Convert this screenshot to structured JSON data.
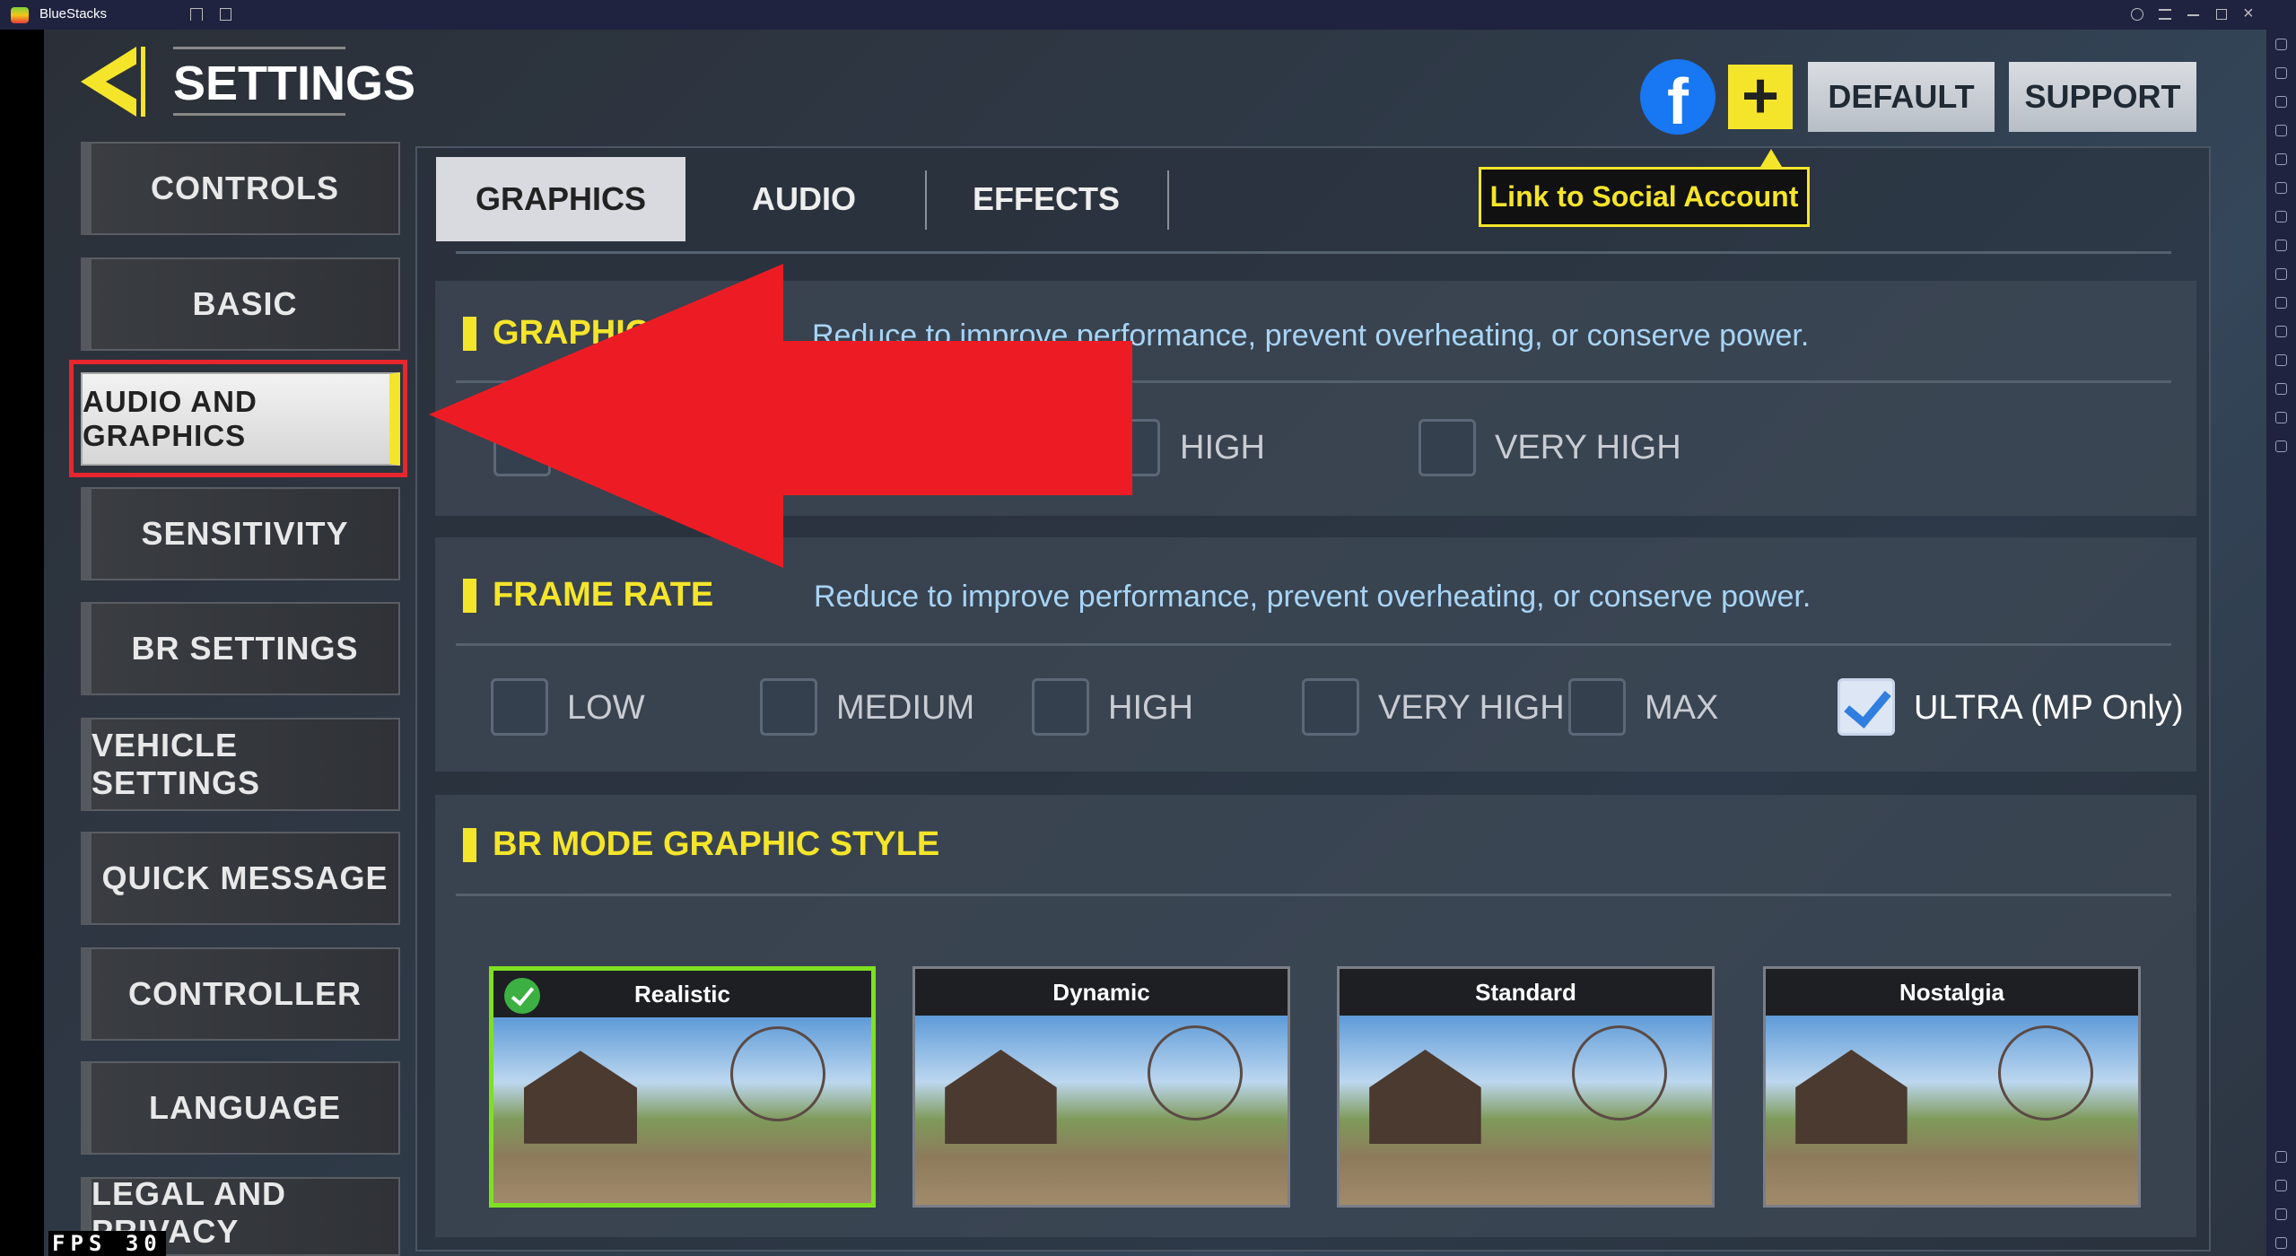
{
  "window": {
    "title": "BlueStacks"
  },
  "header": {
    "title": "SETTINGS",
    "default_label": "DEFAULT",
    "support_label": "SUPPORT",
    "tooltip": "Link to Social Account"
  },
  "sidebar": {
    "items": [
      {
        "label": "CONTROLS"
      },
      {
        "label": "BASIC"
      },
      {
        "label": "AUDIO AND GRAPHICS",
        "selected": true
      },
      {
        "label": "SENSITIVITY"
      },
      {
        "label": "BR SETTINGS"
      },
      {
        "label": "VEHICLE SETTINGS"
      },
      {
        "label": "QUICK MESSAGE"
      },
      {
        "label": "CONTROLLER"
      },
      {
        "label": "LANGUAGE"
      },
      {
        "label": "LEGAL AND PRIVACY"
      }
    ]
  },
  "tabs": [
    {
      "label": "GRAPHICS",
      "selected": true
    },
    {
      "label": "AUDIO"
    },
    {
      "label": "EFFECTS"
    }
  ],
  "graphic_section": {
    "title": "GRAPHIC S",
    "desc": "Reduce to improve performance, prevent overheating, or conserve power.",
    "options": [
      {
        "label": "HIGH"
      },
      {
        "label": "VERY HIGH"
      }
    ]
  },
  "frame_rate": {
    "title": "FRAME RATE",
    "desc": "Reduce to improve performance, prevent overheating, or conserve power.",
    "options": [
      {
        "label": "LOW",
        "checked": false
      },
      {
        "label": "MEDIUM",
        "checked": false
      },
      {
        "label": "HIGH",
        "checked": false
      },
      {
        "label": "VERY HIGH",
        "checked": false
      },
      {
        "label": "MAX",
        "checked": false
      },
      {
        "label": "ULTRA (MP Only)",
        "checked": true
      }
    ]
  },
  "br_style": {
    "title": "BR MODE GRAPHIC STYLE",
    "cards": [
      {
        "label": "Realistic",
        "selected": true
      },
      {
        "label": "Dynamic"
      },
      {
        "label": "Standard"
      },
      {
        "label": "Nostalgia"
      }
    ]
  },
  "overlay": {
    "fps_label": "FPS",
    "fps_value": "30"
  },
  "colors": {
    "accent": "#f5e52a",
    "annotation_arrow": "#ed1c24",
    "facebook": "#1877f2"
  }
}
